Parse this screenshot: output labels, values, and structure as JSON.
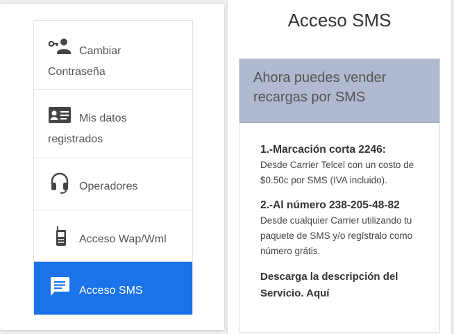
{
  "sidebar": {
    "items": [
      {
        "label": "Cambiar Contraseña",
        "icon": "key-person-icon",
        "active": false
      },
      {
        "label": "Mis datos registrados",
        "icon": "id-card-icon",
        "active": false
      },
      {
        "label": "Operadores",
        "icon": "headset-icon",
        "active": false
      },
      {
        "label": "Acceso Wap/Wml",
        "icon": "mobile-phone-icon",
        "active": false
      },
      {
        "label": "Acceso SMS",
        "icon": "sms-message-icon",
        "active": true
      }
    ]
  },
  "main": {
    "title": "Acceso SMS",
    "banner": "Ahora puedes vender recargas por SMS",
    "steps": [
      {
        "title": "1.-Marcación corta 2246:",
        "text": "Desde Carrier Telcel con un costo de $0.50c por SMS (IVA incluido)."
      },
      {
        "title": "2.-Al número 238-205-48-82",
        "text": "Desde cualquier Carrier utilizando tu paquete de SMS y/o regístralo como número grátis."
      }
    ],
    "download_text": "Descarga la descripción del Servicio. Aquí"
  },
  "colors": {
    "active_item": "#1a73e8",
    "banner_bg": "#b0b9cf"
  }
}
